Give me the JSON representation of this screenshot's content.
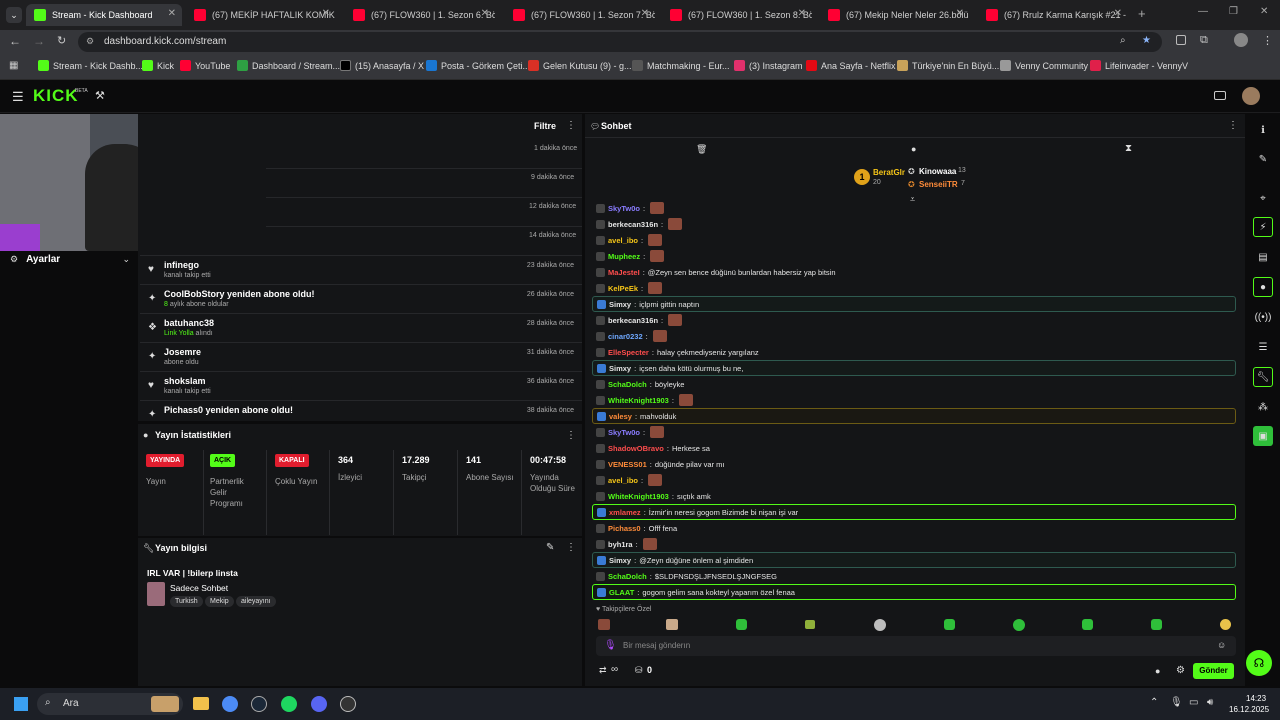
{
  "browser": {
    "tabs": [
      {
        "title": "Stream - Kick Dashboard",
        "active": true
      },
      {
        "title": "(67) MEKİP HAFTALIK KOMİK A"
      },
      {
        "title": "(67) FLOW360 | 1. Sezon 6. Böl"
      },
      {
        "title": "(67) FLOW360 | 1. Sezon 7. Böl"
      },
      {
        "title": "(67) FLOW360 | 1. Sezon 8. Böl"
      },
      {
        "title": "(67) Mekip Neler Neler 26.bölü"
      },
      {
        "title": "(67) Rrulz Karma Karışık #21 -"
      }
    ],
    "url": "dashboard.kick.com/stream",
    "bookmarks": [
      "Stream - Kick Dashb...",
      "Kick",
      "YouTube",
      "Dashboard / Stream...",
      "(15) Anasayfa / X",
      "Posta - Görkem Çeti...",
      "Gelen Kutusu (9) - g...",
      "Matchmaking - Eur...",
      "(3) Instagram",
      "Ana Sayfa - Netflix",
      "Türkiye'nin En Büyü...",
      "Venny Community",
      "Lifeinvader - VennyV"
    ]
  },
  "kick": {
    "logo": "KICK",
    "beta": "BETA"
  },
  "sidebar": {
    "settings_label": "Ayarlar"
  },
  "activity": {
    "filter_label": "Filtre",
    "top_times": [
      "1 dakika önce",
      "9 dakika önce",
      "12 dakika önce",
      "14 dakika önce"
    ],
    "rows": [
      {
        "name": "infinego",
        "sub": "kanalı takip etti",
        "time": "23 dakika önce",
        "icon": "heart-icon"
      },
      {
        "name": "CoolBobStory yeniden abone oldu!",
        "sub_count": "8",
        "sub": "aylık abone oldular",
        "time": "26 dakika önce",
        "icon": "star-icon"
      },
      {
        "name": "batuhanc38",
        "sub_link": "Link Yolla",
        "sub": "alındı",
        "time": "28 dakika önce",
        "icon": "gift-icon"
      },
      {
        "name": "Josemre",
        "sub": "abone oldu",
        "time": "31 dakika önce",
        "icon": "star-icon"
      },
      {
        "name": "shokslam",
        "sub": "kanalı takip etti",
        "time": "36 dakika önce",
        "icon": "heart-icon"
      },
      {
        "name": "Pichass0 yeniden abone oldu!",
        "sub": "",
        "time": "38 dakika önce",
        "icon": "star-icon"
      }
    ]
  },
  "stats": {
    "title": "Yayın İstatistikleri",
    "stream_badge": "YAYINDA",
    "stream_label": "Yayın",
    "partner_badge": "AÇIK",
    "partner_label": "Partnerlik Gelir Programı",
    "multi_badge": "KAPALI",
    "multi_label": "Çoklu Yayın",
    "viewers": "364",
    "viewers_label": "İzleyici",
    "followers": "17.289",
    "followers_label": "Takipçi",
    "subs": "141",
    "subs_label": "Abone Sayısı",
    "uptime": "00:47:58",
    "uptime_label": "Yayında Olduğu Süre"
  },
  "stream_info": {
    "title": "Yayın bilgisi",
    "stream_title": "IRL VAR | !bilerp linsta",
    "category": "Sadece Sohbet",
    "tags": [
      "Turkish",
      "Mekip",
      "aileyayını"
    ]
  },
  "chat": {
    "title": "Sohbet",
    "leaderboard": {
      "first_name": "BeratGlr",
      "first_count": "20",
      "second_name": "Kinowaaa",
      "second_count": "13",
      "third_name": "SenseiiTR",
      "third_count": "7"
    },
    "messages": [
      {
        "user": "SkyTw0o",
        "color": "#8a7cff",
        "text": "",
        "emote": true
      },
      {
        "user": "berkecan316n",
        "color": "#e6e6e6",
        "text": "",
        "emote": true
      },
      {
        "user": "avel_ibo",
        "color": "#f5c518",
        "text": "",
        "emote": true
      },
      {
        "user": "Mupheez",
        "color": "#53fc18",
        "text": "",
        "emote": true
      },
      {
        "user": "MaJesteI",
        "color": "#ff4d4d",
        "text": "@Zeyn sen bence düğünü bunlardan habersiz yap bitsin",
        "emote": false
      },
      {
        "user": "KelPeEk",
        "color": "#f5c518",
        "text": "",
        "emote": true
      },
      {
        "user": "Simxy",
        "color": "#e6e6e6",
        "text": "içlpmi gittin naptın",
        "emote": false,
        "hl": "hl"
      },
      {
        "user": "berkecan316n",
        "color": "#e6e6e6",
        "text": "",
        "emote": true
      },
      {
        "user": "cinar0232",
        "color": "#6fa8ff",
        "text": "",
        "emote": true
      },
      {
        "user": "ElleSpecter",
        "color": "#ff4d4d",
        "text": "halay çekmediyseniz yargılanz",
        "emote": false
      },
      {
        "user": "Simxy",
        "color": "#e6e6e6",
        "text": "içsen daha kötü olurmuş bu ne,",
        "emote": false,
        "hl": "hl"
      },
      {
        "user": "SchaDolch",
        "color": "#53fc18",
        "text": "böyleyke",
        "emote": false
      },
      {
        "user": "WhiteKnight1903",
        "color": "#53fc18",
        "text": "",
        "emote": true
      },
      {
        "user": "valesy",
        "color": "#ff8c3a",
        "text": "mahvolduk",
        "emote": false,
        "hl": "hly"
      },
      {
        "user": "SkyTw0o",
        "color": "#8a7cff",
        "text": "",
        "emote": true
      },
      {
        "user": "ShadowOBravo",
        "color": "#ff4d4d",
        "text": "Herkese sa",
        "emote": false
      },
      {
        "user": "VENESS01",
        "color": "#ff8c3a",
        "text": "düğünde pilav var mı",
        "emote": false
      },
      {
        "user": "avel_ibo",
        "color": "#f5c518",
        "text": "",
        "emote": true
      },
      {
        "user": "WhiteKnight1903",
        "color": "#53fc18",
        "text": "sıçtık amk",
        "emote": false
      },
      {
        "user": "xmlamez",
        "color": "#ff4d4d",
        "text": "İzmir'in neresi gogom Bizimde bi nişan işi var",
        "emote": false,
        "hl": "hlg"
      },
      {
        "user": "Pichass0",
        "color": "#ff8c3a",
        "text": "Offf fena",
        "emote": false
      },
      {
        "user": "byh1ra",
        "color": "#e6e6e6",
        "text": "",
        "emote": true
      },
      {
        "user": "Simxy",
        "color": "#e6e6e6",
        "text": "@Zeyn düğüne önlem al şimdiden",
        "emote": false,
        "hl": "hl"
      },
      {
        "user": "SchaDolch",
        "color": "#53fc18",
        "text": "$SLDFNSDŞLJFNSEDLŞJNGFSEG",
        "emote": false
      },
      {
        "user": "GLAAT",
        "color": "#53fc18",
        "text": "gogom gelim sana kokteyl yaparım özel fenaa",
        "emote": false,
        "hl": "hlg"
      }
    ],
    "followers_label": "Takipçilere Özel",
    "input_placeholder": "Bir mesaj gönderın",
    "loop_count": "∞",
    "bucket_count": "0",
    "send_label": "Gönder"
  },
  "taskbar": {
    "search_label": "Ara",
    "time": "14:23",
    "date": "16.12.2025"
  }
}
